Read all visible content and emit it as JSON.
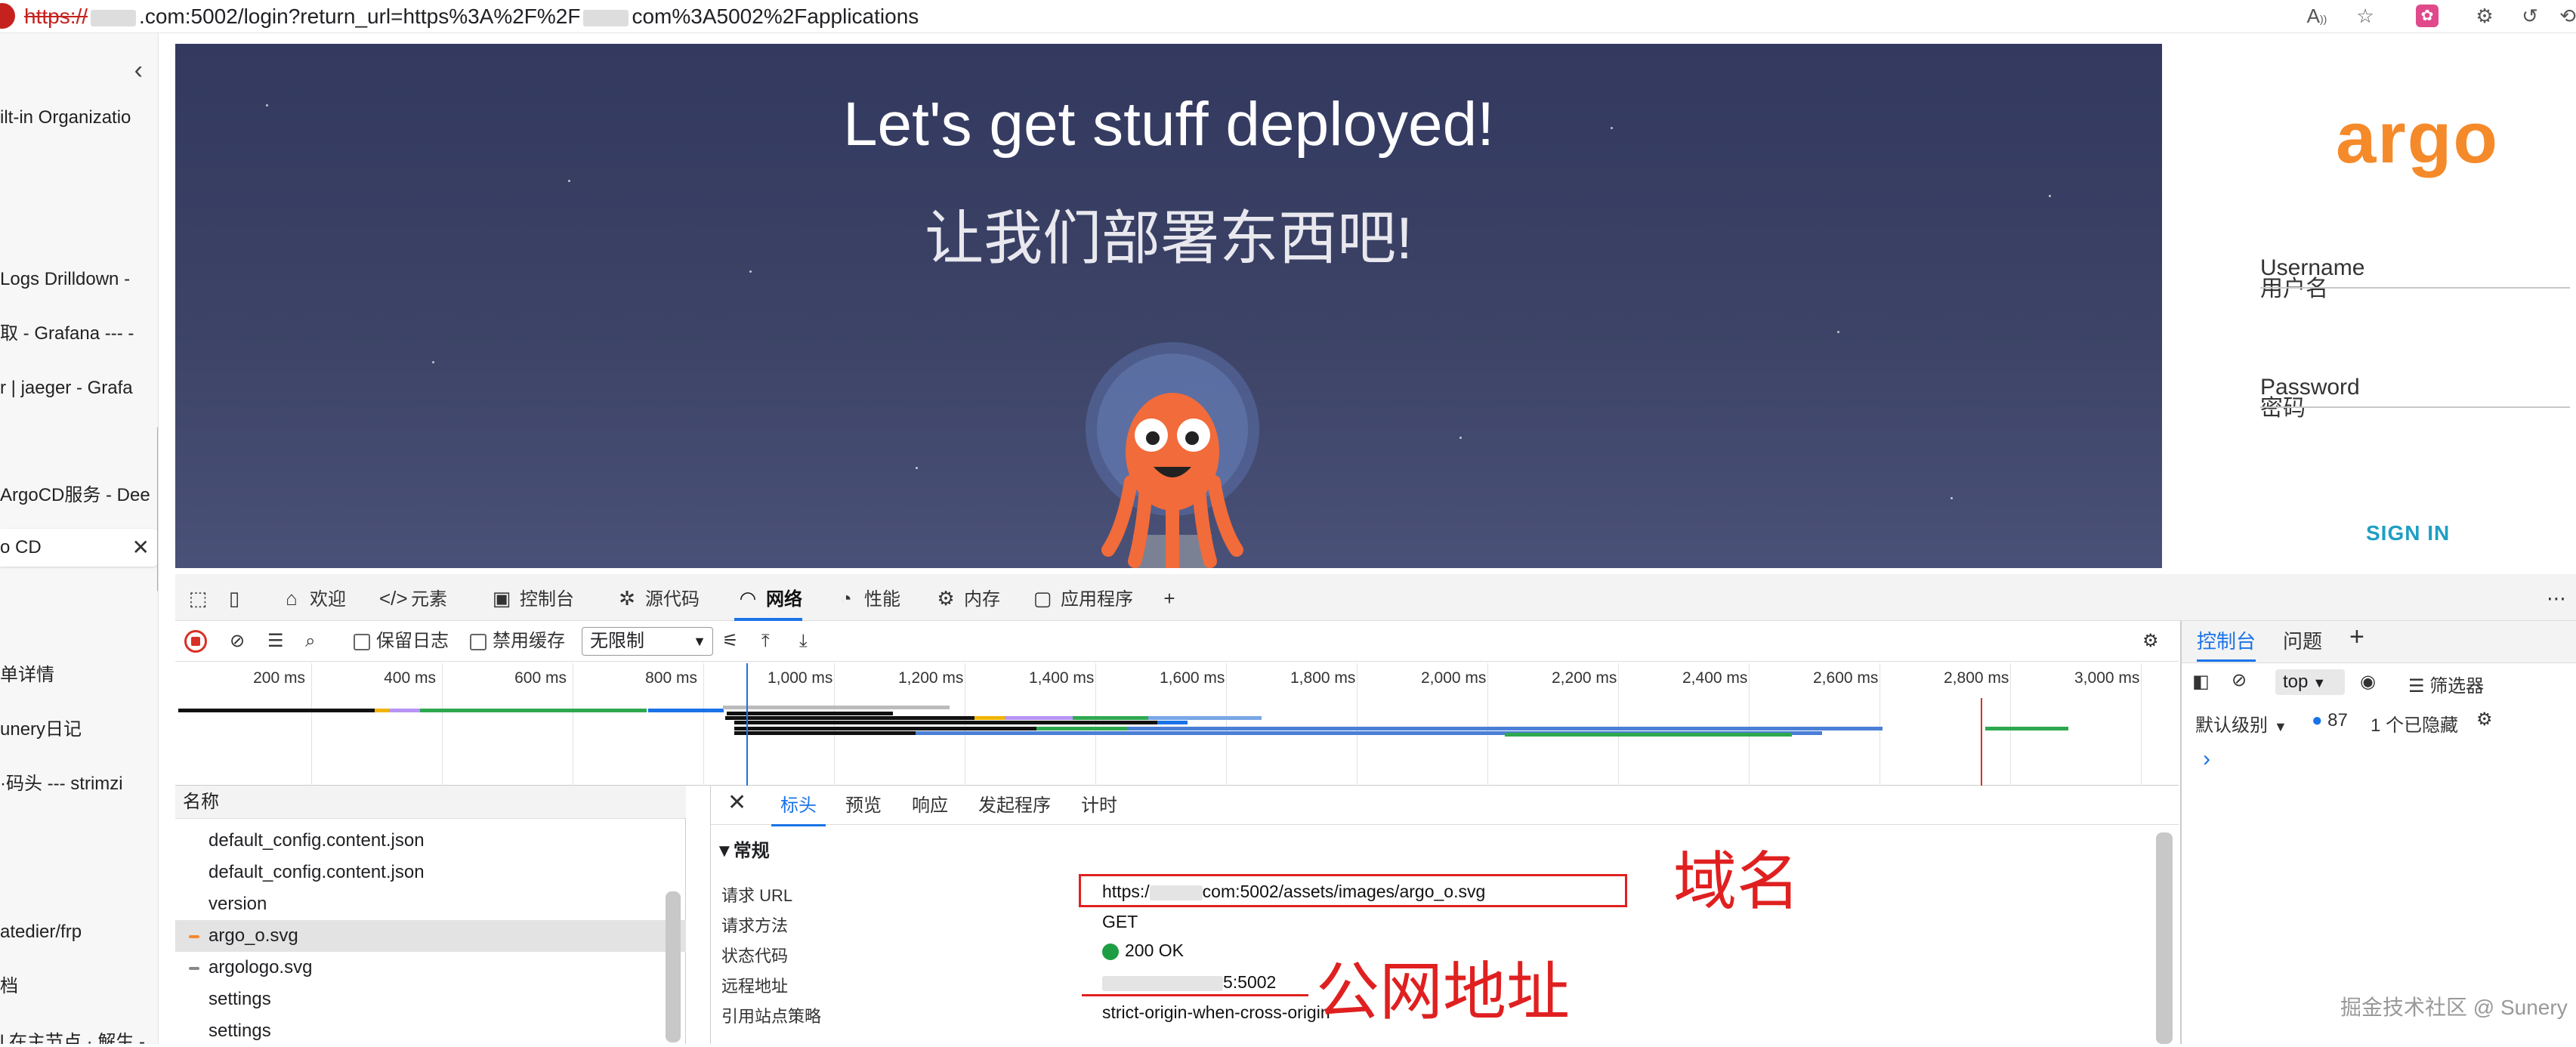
{
  "address_bar": {
    "scheme": "https://",
    "url_part1": ".com:5002/login?return_url=https%3A%2F%2F",
    "url_part2": "com%3A5002%2Fapplications",
    "icons": [
      "read-aloud-icon",
      "favorite-star-icon",
      "extension-icon",
      "settings-icon",
      "history-icon"
    ]
  },
  "sidebar": {
    "items": [
      {
        "label": "ilt-in Organizatio"
      },
      {
        "label": " Logs Drilldown -"
      },
      {
        "label": "取 - Grafana --- -"
      },
      {
        "label": "r | jaeger - Grafa"
      },
      {
        "label": "ArgoCD服务 - Dee"
      },
      {
        "label": "o CD"
      },
      {
        "label": "单详情"
      },
      {
        "label": "unery日记"
      },
      {
        "label": "·码头 --- strimzi"
      },
      {
        "label": "atedier/frp"
      },
      {
        "label": "档"
      },
      {
        "label": "l 在主节点 · 解生 -"
      }
    ],
    "close_glyph": "✕",
    "collapse_glyph": "‹"
  },
  "hero": {
    "title": "Let's get stuff deployed!",
    "subtitle": "让我们部署东西吧!"
  },
  "login": {
    "logo": "argo",
    "username_label": "Username",
    "username_label_cn": "用户名",
    "password_label": "Password",
    "password_label_cn": "密码",
    "signin": "SIGN IN"
  },
  "devtools": {
    "tabs": [
      {
        "icon": "inspect-icon",
        "label": ""
      },
      {
        "icon": "device-icon",
        "label": ""
      },
      {
        "icon": "home-icon",
        "glyph": "⌂",
        "label": "欢迎"
      },
      {
        "icon": "code-icon",
        "glyph": "</>",
        "label": "元素"
      },
      {
        "icon": "console-icon",
        "glyph": "▣",
        "label": "控制台"
      },
      {
        "icon": "bug-icon",
        "glyph": "✲",
        "label": "源代码"
      },
      {
        "icon": "wifi-icon",
        "glyph": "◠",
        "label": "网络"
      },
      {
        "icon": "gauge-icon",
        "glyph": "◔",
        "label": "性能"
      },
      {
        "icon": "memory-icon",
        "glyph": "⚙",
        "label": "内存"
      },
      {
        "icon": "app-icon",
        "glyph": "▢",
        "label": "应用程序"
      },
      {
        "icon": "plus-icon",
        "glyph": "+",
        "label": ""
      }
    ],
    "selected_tab": "网络",
    "toolbar": {
      "preserve_log": "保留日志",
      "disable_cache": "禁用缓存",
      "throttle": "无限制"
    },
    "timeline_ticks": [
      "200 ms",
      "400 ms",
      "600 ms",
      "800 ms",
      "1,000 ms",
      "1,200 ms",
      "1,400 ms",
      "1,600 ms",
      "1,800 ms",
      "2,000 ms",
      "2,200 ms",
      "2,400 ms",
      "2,600 ms",
      "2,800 ms",
      "3,000 ms"
    ],
    "request_list": {
      "header": "名称",
      "rows": [
        {
          "name": "default_config.content.json",
          "type": "json",
          "selected": false
        },
        {
          "name": "default_config.content.json",
          "type": "json",
          "selected": false
        },
        {
          "name": "version",
          "type": "doc",
          "selected": false
        },
        {
          "name": "argo_o.svg",
          "type": "svg",
          "selected": true
        },
        {
          "name": "argologo.svg",
          "type": "svg",
          "selected": false
        },
        {
          "name": "settings",
          "type": "doc",
          "selected": false
        },
        {
          "name": "settings",
          "type": "doc",
          "selected": false
        }
      ]
    },
    "detail_tabs": [
      "标头",
      "预览",
      "响应",
      "发起程序",
      "计时"
    ],
    "detail_selected": "标头",
    "section": "▼常规",
    "general": [
      {
        "key": "请求 URL",
        "value_pre": "https:/",
        "value_post": "com:5002/assets/images/argo_o.svg"
      },
      {
        "key": "请求方法",
        "value": "GET"
      },
      {
        "key": "状态代码",
        "value": "200 OK"
      },
      {
        "key": "远程地址",
        "value_post": "5:5002"
      },
      {
        "key": "引用站点策略",
        "value": "strict-origin-when-cross-origin"
      }
    ]
  },
  "drawer": {
    "tabs": [
      "控制台",
      "问题"
    ],
    "context": "top",
    "filter": "筛选器",
    "level": "默认级别",
    "count": "87",
    "hidden": "1 个已隐藏"
  },
  "annotations": {
    "domain": "域名",
    "public_addr": "公网地址",
    "watermark": "掘金技术社区 @ Sunery"
  },
  "colors": {
    "accent": "#1a73e8",
    "argo_orange": "#f58a2a",
    "hero_bg": "#3a4064",
    "annotation": "#e02020",
    "signin": "#1f9ec4"
  }
}
